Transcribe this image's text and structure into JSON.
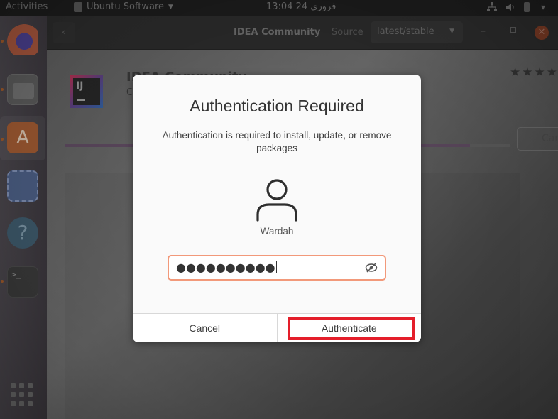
{
  "topbar": {
    "activities_label": "Activities",
    "app_menu_label": "Ubuntu Software",
    "clock": "13:04  24 فروری",
    "tray": [
      "network-icon",
      "volume-icon",
      "battery-icon",
      "system-menu-icon"
    ]
  },
  "dock": {
    "items": [
      {
        "name": "firefox",
        "running": true
      },
      {
        "name": "files",
        "running": true
      },
      {
        "name": "ubuntu-software",
        "running": true,
        "active": true,
        "glyph": "A"
      },
      {
        "name": "screenshot",
        "running": false
      },
      {
        "name": "help",
        "running": false,
        "glyph": "?"
      },
      {
        "name": "terminal",
        "running": true,
        "glyph": ">_"
      },
      {
        "name": "show-applications",
        "running": false
      }
    ]
  },
  "window": {
    "header": {
      "back_glyph": "‹",
      "title": "IDEA Community",
      "source_label": "Source",
      "channel_selected": "latest/stable",
      "minimize_glyph": "–",
      "close_glyph": "✕"
    },
    "app": {
      "icon_text": "IJ",
      "name": "IDEA Community",
      "developer": "C",
      "rating_stars": "★★★★",
      "cancel_label": "Cancel",
      "install_progress": 0.91
    }
  },
  "dialog": {
    "title": "Authentication Required",
    "message": "Authentication is required to install, update, or remove packages",
    "user_name": "Wardah",
    "password_masked": "●●●●●●●●●●",
    "cancel_label": "Cancel",
    "authenticate_label": "Authenticate",
    "accent_color": "#f2997a",
    "highlight_color": "#e41e2a"
  }
}
